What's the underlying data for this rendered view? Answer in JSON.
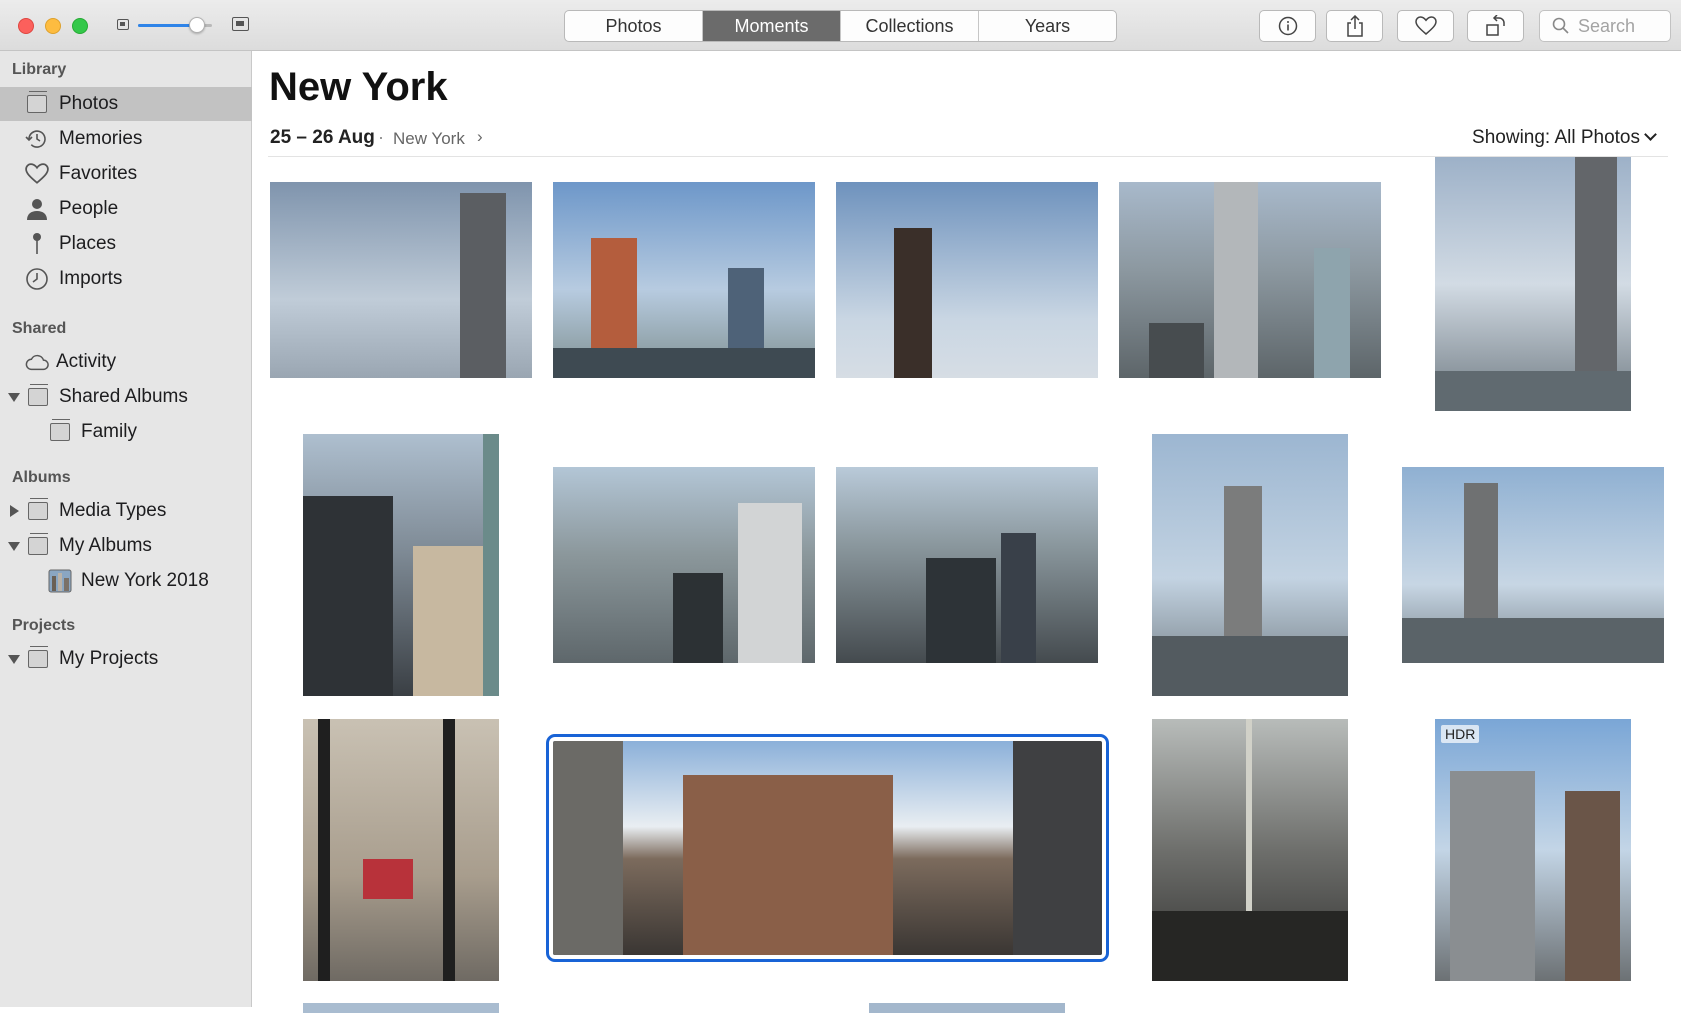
{
  "window": {
    "segments": [
      "Photos",
      "Moments",
      "Collections",
      "Years"
    ],
    "active_segment": "Moments",
    "zoom_level": 0.8,
    "search_placeholder": "Search",
    "toolbar_icons": [
      "info-icon",
      "share-icon",
      "heart-icon",
      "rotate-icon"
    ]
  },
  "sidebar": {
    "library_header": "Library",
    "library": [
      {
        "label": "Photos",
        "icon": "photos-icon",
        "selected": true
      },
      {
        "label": "Memories",
        "icon": "memories-icon"
      },
      {
        "label": "Favorites",
        "icon": "heart-icon"
      },
      {
        "label": "People",
        "icon": "person-icon"
      },
      {
        "label": "Places",
        "icon": "pin-icon"
      },
      {
        "label": "Imports",
        "icon": "clock-icon"
      }
    ],
    "shared_header": "Shared",
    "shared": [
      {
        "label": "Activity",
        "icon": "cloud-icon"
      },
      {
        "label": "Shared Albums",
        "icon": "album-stack-icon",
        "expanded": true
      },
      {
        "label": "Family",
        "icon": "album-stack-icon"
      }
    ],
    "albums_header": "Albums",
    "albums": [
      {
        "label": "Media Types",
        "icon": "album-stack-icon",
        "expanded": false
      },
      {
        "label": "My Albums",
        "icon": "album-stack-icon",
        "expanded": true
      },
      {
        "label": "New York 2018",
        "icon": "album-thumbnail-icon"
      }
    ],
    "projects_header": "Projects",
    "projects": [
      {
        "label": "My Projects",
        "icon": "album-stack-icon",
        "expanded": true
      }
    ]
  },
  "main": {
    "title": "New York",
    "date_range": "25 – 26 Aug",
    "separator": "·",
    "location": "New York",
    "showing_label": "Showing: All Photos",
    "photos": [
      {
        "subject": "skyscraper-clouds"
      },
      {
        "subject": "construction-crane"
      },
      {
        "subject": "crane-tower"
      },
      {
        "subject": "city-aerial"
      },
      {
        "subject": "tall-tower"
      },
      {
        "subject": "midtown-buildings"
      },
      {
        "subject": "skyline-view"
      },
      {
        "subject": "skyline-view-2"
      },
      {
        "subject": "empire-state"
      },
      {
        "subject": "empire-state-wide"
      },
      {
        "subject": "flags-plaza"
      },
      {
        "subject": "street-panorama",
        "selected": true
      },
      {
        "subject": "subway-car"
      },
      {
        "subject": "street-hdr",
        "badge": "HDR"
      }
    ]
  }
}
